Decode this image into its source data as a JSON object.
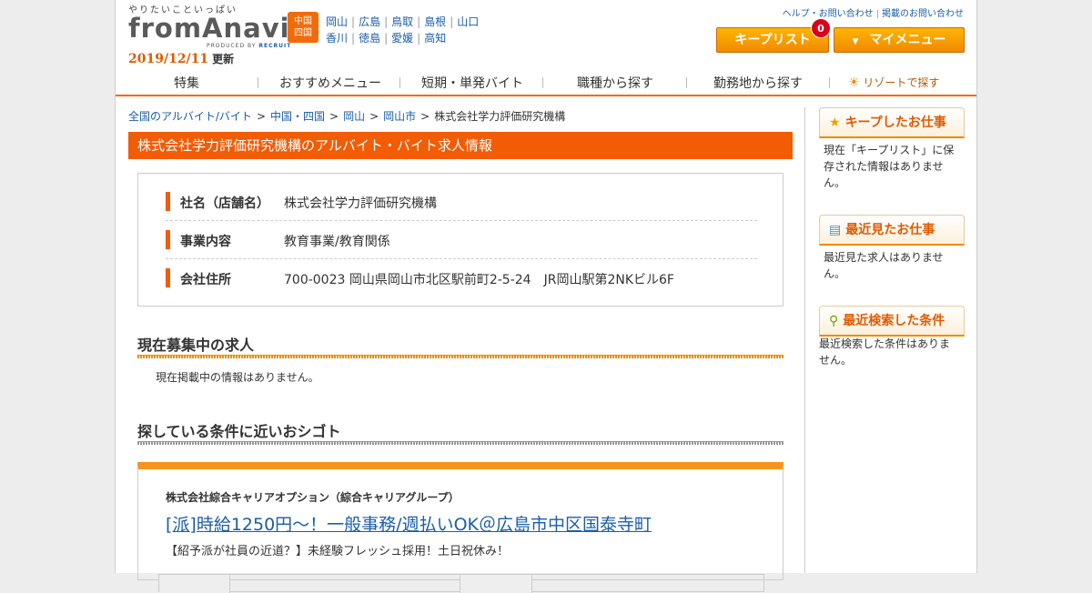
{
  "header": {
    "tagline": "やりたいこといっぱい",
    "logo": "fromAnavi",
    "produced_by": "PRODUCED BY",
    "recruit": "RECRUIT",
    "date": "2019/12/11",
    "date_suffix": "更新",
    "region_badge_line1": "中国",
    "region_badge_line2": "四国",
    "region_links_row1": [
      "岡山",
      "広島",
      "鳥取",
      "島根",
      "山口"
    ],
    "region_links_row2": [
      "香川",
      "徳島",
      "愛媛",
      "高知"
    ],
    "help_link": "ヘルプ・お問い合わせ",
    "ad_link": "掲載のお問い合わせ",
    "keep_list_label": "キープリスト",
    "keep_count": "0",
    "my_menu_label": "マイメニュー"
  },
  "nav": {
    "items": [
      "特集",
      "おすすめメニュー",
      "短期・単発バイト",
      "職種から探す",
      "勤務地から探す"
    ],
    "resort": "リゾートで探す"
  },
  "breadcrumb": {
    "items": [
      "全国のアルバイト/バイト",
      "中国・四国",
      "岡山",
      "岡山市"
    ],
    "current": "株式会社学力評価研究機構"
  },
  "main": {
    "title": "株式会社学力評価研究機構のアルバイト・バイト求人情報",
    "company_rows": [
      {
        "label": "社名（店舗名）",
        "value": "株式会社学力評価研究機構"
      },
      {
        "label": "事業内容",
        "value": "教育事業/教育関係"
      },
      {
        "label": "会社住所",
        "value": "700-0023 岡山県岡山市北区駅前町2-5-24　JR岡山駅第2NKビル6F"
      }
    ],
    "current_jobs_title": "現在募集中の求人",
    "no_info": "現在掲載中の情報はありません。",
    "similar_title": "探している条件に近いおシゴト",
    "job": {
      "company": "株式会社綜合キャリアオプション（綜合キャリアグループ）",
      "title": "[派]時給1250円～！一般事務/週払いOK＠広島市中区国泰寺町",
      "catch": "【紹予派が社員の近道？】未経験フレッシュ採用！土日祝休み！"
    }
  },
  "sidebar": {
    "keep_title": "キープしたお仕事",
    "keep_text": "現在「キープリスト」に保存された情報はありません。",
    "recent_title": "最近見たお仕事",
    "recent_text": "最近見た求人はありません。",
    "search_title": "最近検索した条件",
    "search_text": "最近検索した条件はありません。"
  }
}
